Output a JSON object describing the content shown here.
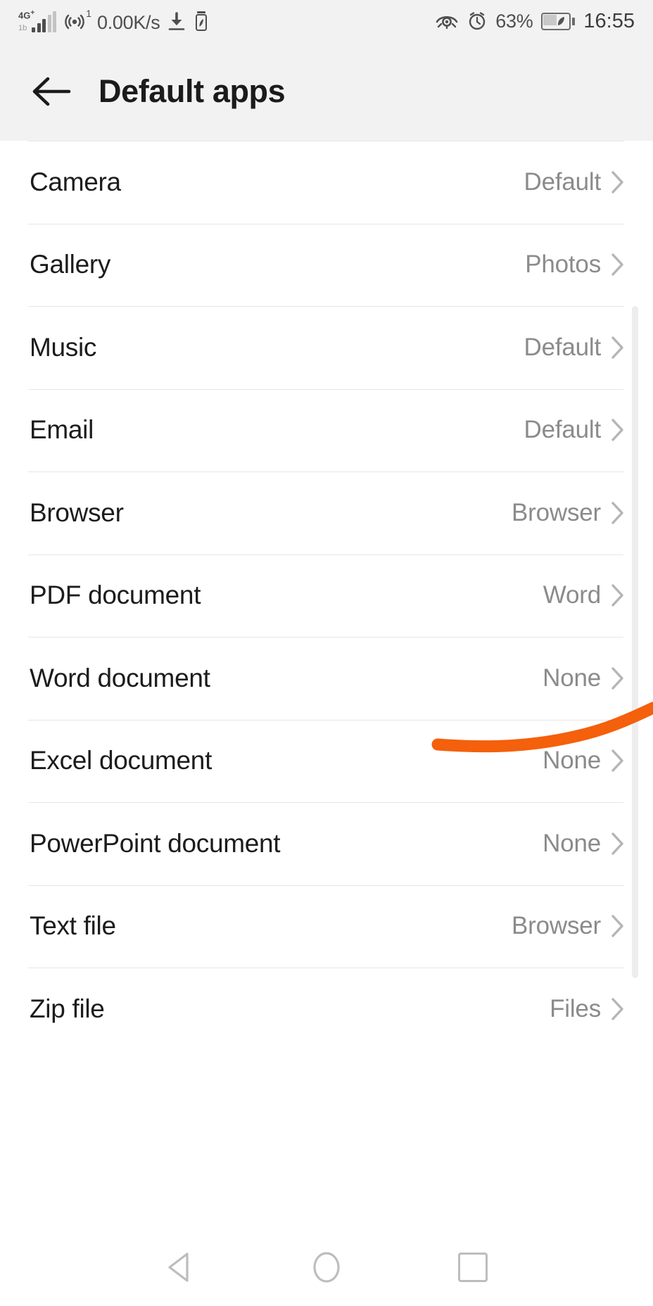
{
  "statusbar": {
    "network_type": "4G",
    "network_plus": "+",
    "volte": "1b",
    "hotspot_count": "1",
    "speed": "0.00K/s",
    "battery_percent": "63%",
    "time": "16:55",
    "icons": {
      "signal": "signal-bars-icon",
      "hotspot": "hotspot-icon",
      "download": "download-icon",
      "small_battery": "battery-saver-icon",
      "eye_comfort": "eye-comfort-icon",
      "alarm": "alarm-clock-icon",
      "battery": "battery-icon"
    }
  },
  "appbar": {
    "back_icon": "back-arrow-icon",
    "title": "Default apps"
  },
  "list": {
    "rows": [
      {
        "label": "Camera",
        "value": "Default"
      },
      {
        "label": "Gallery",
        "value": "Photos"
      },
      {
        "label": "Music",
        "value": "Default"
      },
      {
        "label": "Email",
        "value": "Default"
      },
      {
        "label": "Browser",
        "value": "Browser"
      },
      {
        "label": "PDF document",
        "value": "Word"
      },
      {
        "label": "Word document",
        "value": "None"
      },
      {
        "label": "Excel document",
        "value": "None"
      },
      {
        "label": "PowerPoint document",
        "value": "None"
      },
      {
        "label": "Text file",
        "value": "Browser"
      },
      {
        "label": "Zip file",
        "value": "Files"
      }
    ]
  },
  "annotation": {
    "color": "#f4600c",
    "target_row": "PDF document"
  },
  "navbar": {
    "back": "nav-back-icon",
    "home": "nav-home-icon",
    "recents": "nav-recents-icon"
  },
  "colors": {
    "statusbar_bg": "#f2f2f2",
    "appbar_bg": "#f2f2f2",
    "list_bg": "#ffffff",
    "divider": "#e6e6e6",
    "label": "#1c1c1c",
    "value": "#8b8b8b",
    "accent_annotation": "#f4600c"
  }
}
